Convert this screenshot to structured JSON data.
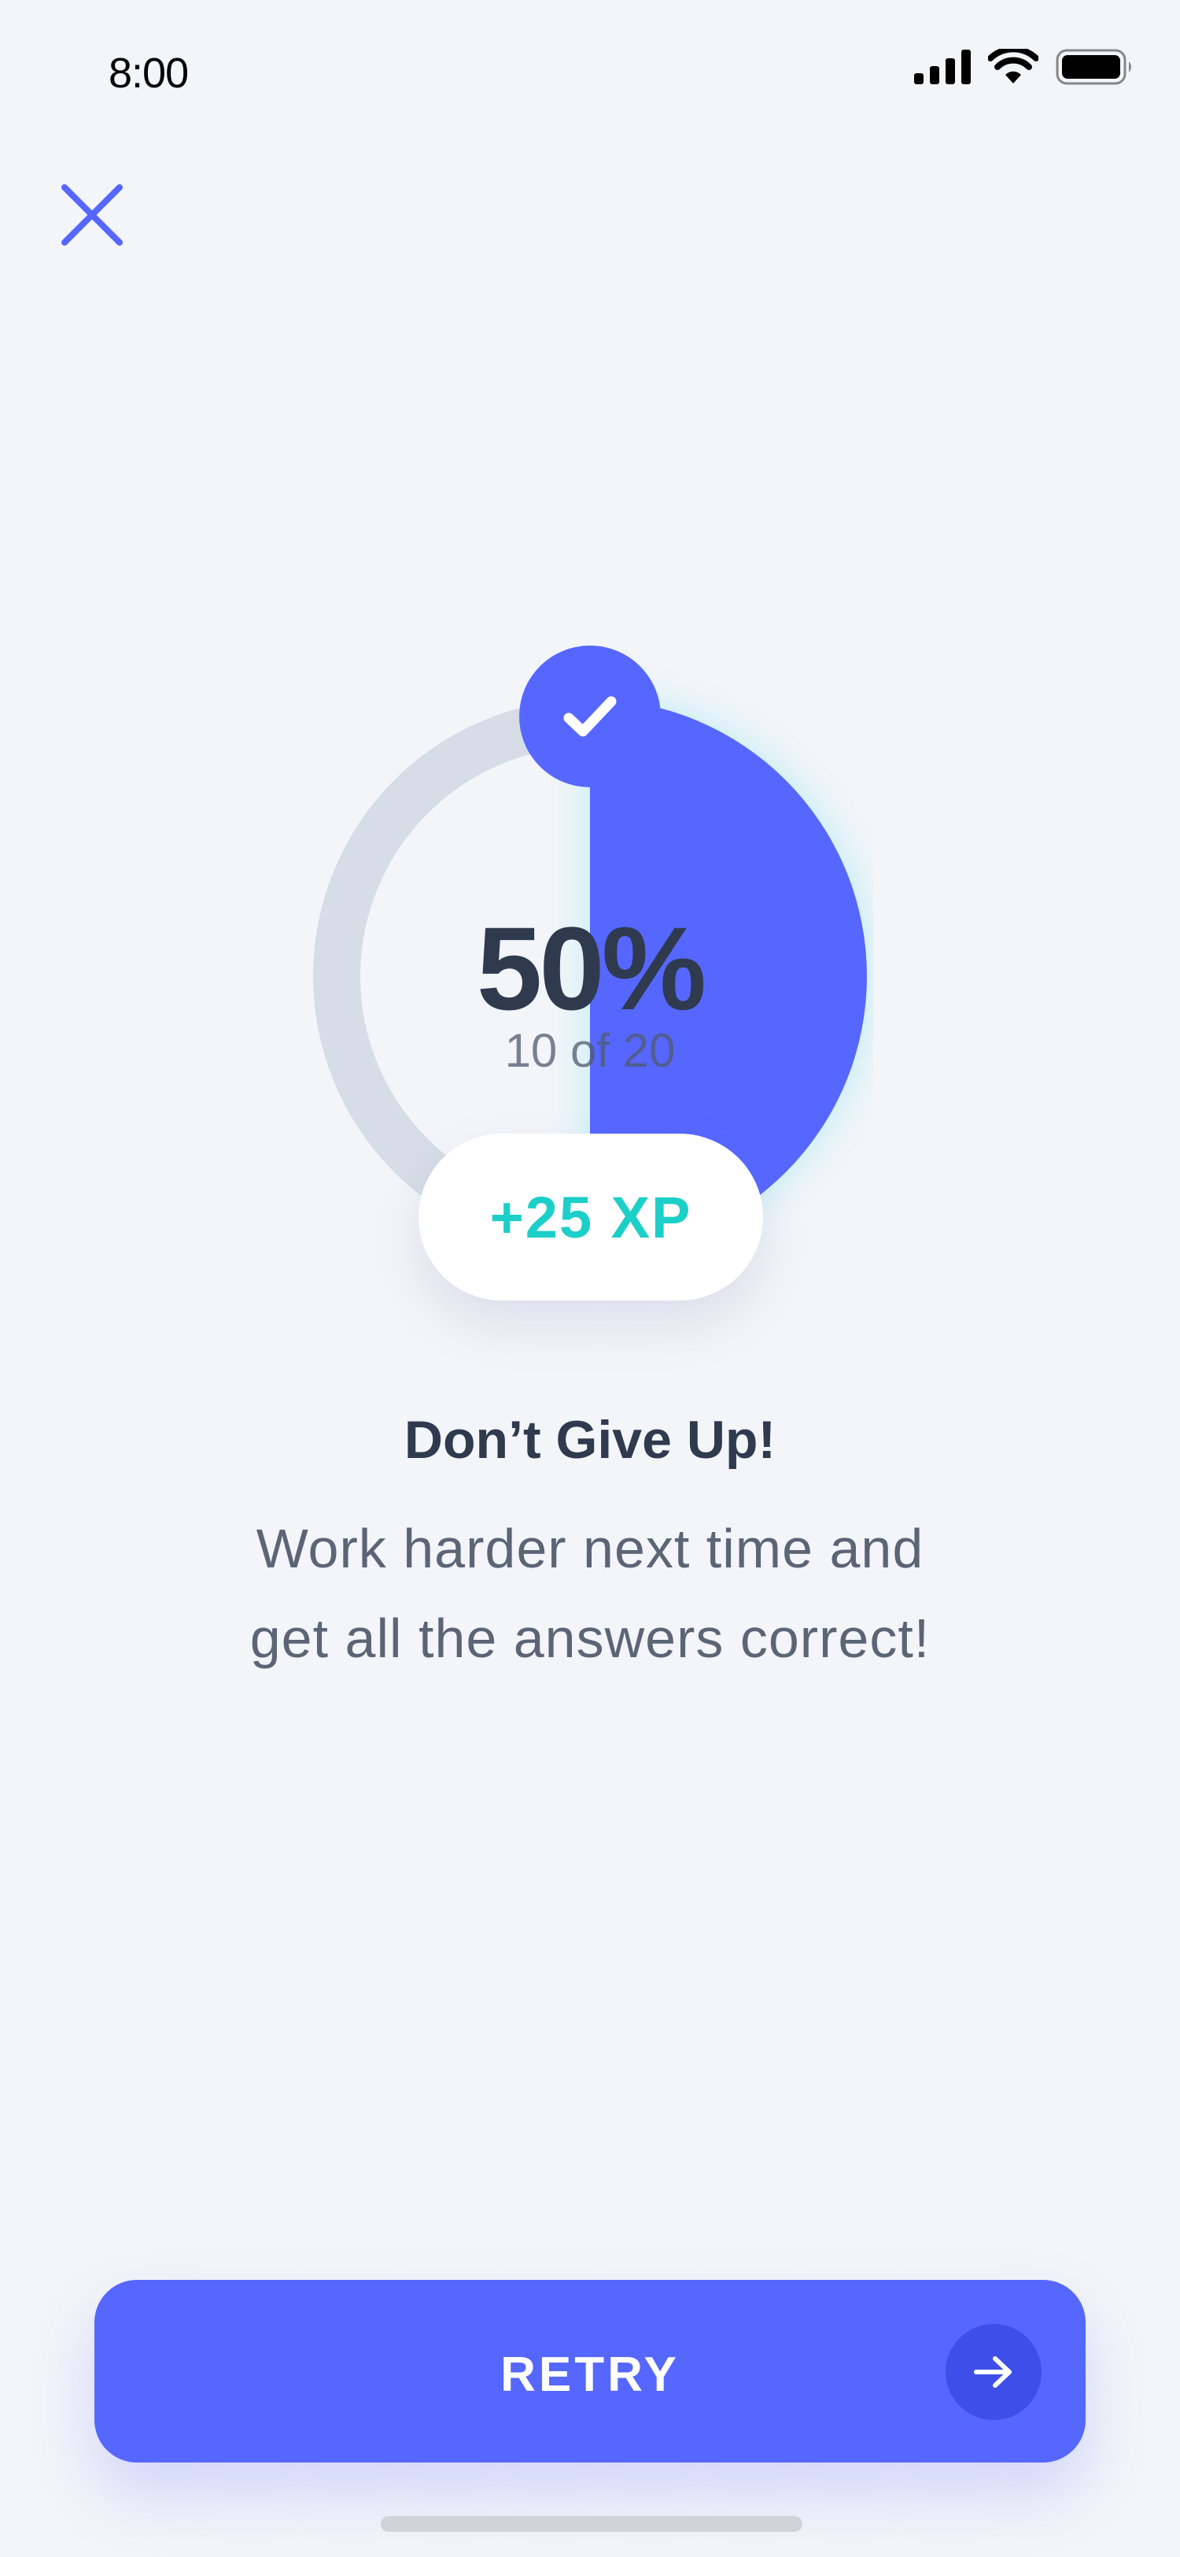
{
  "status_bar": {
    "time": "8:00",
    "icons": [
      "signal-icon",
      "wifi-icon",
      "battery-icon"
    ]
  },
  "close_button": {
    "icon": "close-icon"
  },
  "result": {
    "percent_label": "50%",
    "fraction_label": "10 of 20",
    "progress": 0.5,
    "badge_icon": "check-icon",
    "xp_label": "+25 XP"
  },
  "message": {
    "title": "Don’t Give Up!",
    "line1": "Work harder next time and",
    "line2": "get all the answers correct!"
  },
  "retry_button": {
    "label": "RETRY",
    "icon": "arrow-right-icon"
  },
  "colors": {
    "background": "#f3f5f9",
    "accent": "#5667ff",
    "track": "#d6dde6",
    "xp": "#1ccfc8",
    "text_dark": "#2f3a4e",
    "text_body": "#5b6576"
  }
}
